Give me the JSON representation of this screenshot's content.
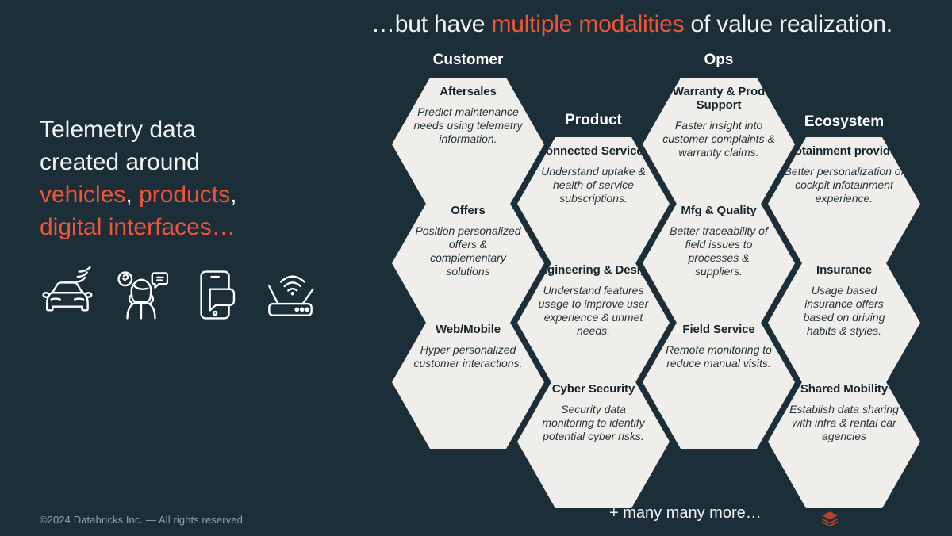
{
  "slide": {
    "background_color": "#1C2F38",
    "accent_color": "#F0553A",
    "hex_fill_color": "#EFEEEA",
    "title_parts": {
      "before": "…but have ",
      "highlight": "multiple modalities",
      "after": " of value realization."
    },
    "lead_parts": {
      "line1": "Telemetry data",
      "line2": "created around",
      "highlight1": "vehicles",
      "sep1": ", ",
      "highlight2": "products",
      "sep2": ",",
      "highlight3": "digital interfaces…"
    },
    "icons": [
      {
        "name": "connected-car-icon",
        "label": "Connected car with signal"
      },
      {
        "name": "customer-persona-icon",
        "label": "Person with search and chat bubbles"
      },
      {
        "name": "smartphone-message-icon",
        "label": "Smartphone with message bubble"
      },
      {
        "name": "router-wifi-icon",
        "label": "Router with wifi signal"
      }
    ],
    "copyright": "©2024 Databricks Inc. — All rights reserved",
    "more_label": "+ many many more…",
    "logo_name": "databricks-logo"
  },
  "columns": [
    {
      "header": "Customer",
      "cells": [
        {
          "title": "Aftersales",
          "body": "Predict maintenance needs using telemetry information."
        },
        {
          "title": "Offers",
          "body": "Position personalized offers & complementary solutions"
        },
        {
          "title": "Web/Mobile",
          "body": "Hyper personalized customer interactions."
        }
      ]
    },
    {
      "header": "Product",
      "cells": [
        {
          "title": "Connected Services",
          "body": "Understand uptake & health of service subscriptions."
        },
        {
          "title": "Engineering & Design",
          "body": "Understand features usage to improve user experience & unmet needs."
        },
        {
          "title": "Cyber Security",
          "body": "Security data monitoring to identify potential cyber risks."
        }
      ]
    },
    {
      "header": "Ops",
      "cells": [
        {
          "title": "Warranty & Prod Support",
          "body": "Faster insight into customer complaints & warranty claims."
        },
        {
          "title": "Mfg & Quality",
          "body": "Better traceability of field issues to processes & suppliers."
        },
        {
          "title": "Field Service",
          "body": "Remote monitoring to reduce manual visits."
        }
      ]
    },
    {
      "header": "Ecosystem",
      "cells": [
        {
          "title": "Infotainment providers",
          "body": "Better personalization of cockpit infotainment experience."
        },
        {
          "title": "Insurance",
          "body": "Usage based insurance offers based on driving habits & styles."
        },
        {
          "title": "Shared Mobility",
          "body": "Establish data sharing with infra & rental car agencies"
        }
      ]
    }
  ]
}
